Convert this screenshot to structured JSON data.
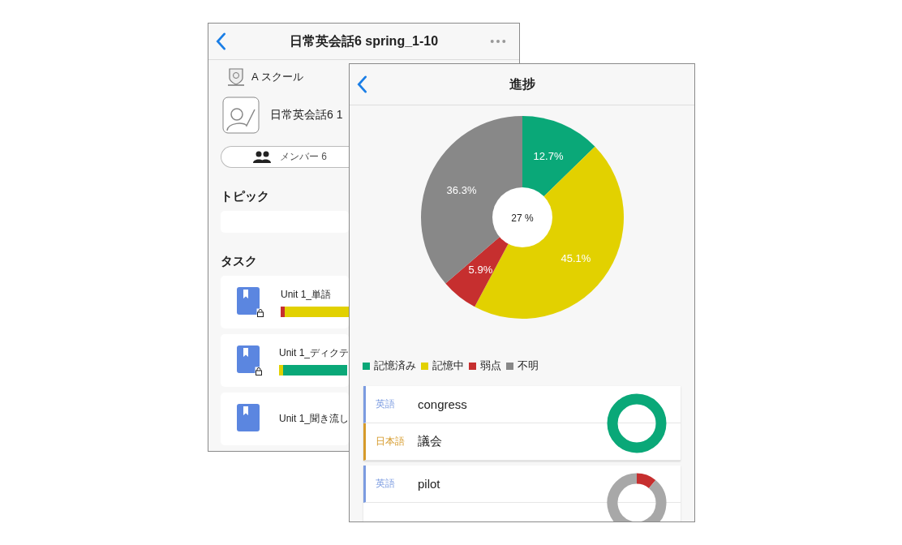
{
  "back_screen": {
    "title": "日常英会話6 spring_1-10",
    "school": "A スクール",
    "course": "日常英会話6 1",
    "members_button": "メンバー 6",
    "topic_heading": "トピック",
    "task_heading": "タスク",
    "tasks": [
      {
        "title": "Unit 1_単語",
        "locked": true,
        "bar": [
          {
            "color": "#c62f2f",
            "level": 0.06
          },
          {
            "color": "#e2d100",
            "level": 0.94
          }
        ]
      },
      {
        "title": "Unit 1_ディクテ",
        "locked": true,
        "bar": [
          {
            "color": "#e2d100",
            "level": 0.06
          },
          {
            "color": "#0aa878",
            "level": 0.94
          }
        ]
      },
      {
        "title": "Unit 1_聞き流し",
        "locked": false
      }
    ]
  },
  "front_screen": {
    "title": "進捗",
    "chart_data": {
      "type": "donut",
      "categories": [
        "記憶済み",
        "記憶中",
        "弱点",
        "不明"
      ],
      "values": [
        12.7,
        45.1,
        5.9,
        36.3
      ],
      "value_labels": [
        "12.7%",
        "45.1%",
        "5.9%",
        "36.3%"
      ]
    },
    "center_label": "27 %",
    "legend": [
      {
        "color": "#0aa878"
      },
      {
        "color": "#e2d100"
      },
      {
        "color": "#c62f2f"
      },
      {
        "color": "#888888"
      }
    ],
    "cards": [
      {
        "rows": [
          {
            "kind": "en",
            "lang": "英語",
            "text": "congress"
          },
          {
            "kind": "ja",
            "lang": "日本語",
            "text": "議会"
          }
        ],
        "kind": "memorized"
      },
      {
        "rows": [
          {
            "kind": "en",
            "lang": "英語",
            "text": "pilot"
          }
        ],
        "kind": "weak"
      }
    ]
  }
}
